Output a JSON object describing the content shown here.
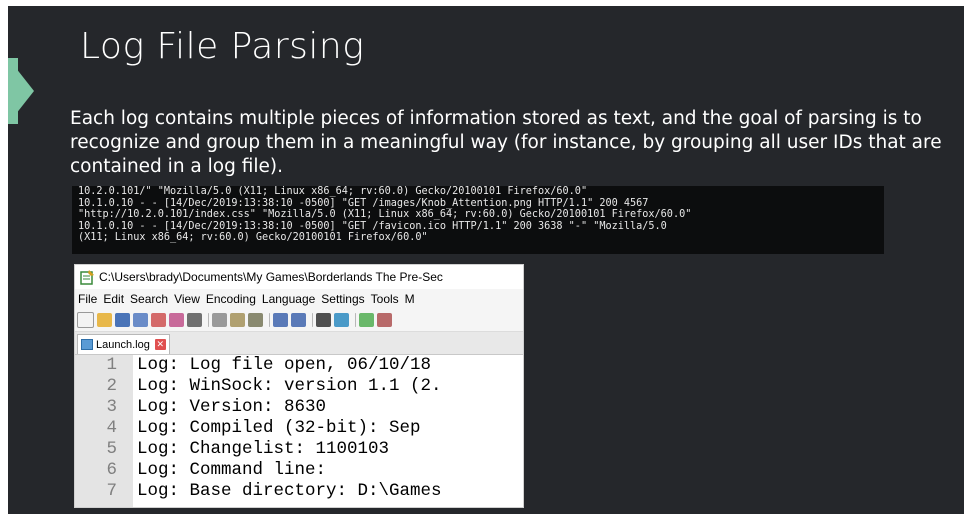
{
  "slide": {
    "title": "Log File Parsing",
    "body": "Each log contains multiple pieces of information stored as text, and the goal of parsing is to recognize and group them in a meaningful way (for instance, by grouping all user IDs that are contained in a log file).",
    "accent_color": "#7fc6a4",
    "background_color": "#25272b"
  },
  "terminal": {
    "lines": [
      "10.2.0.101/\" \"Mozilla/5.0 (X11; Linux x86_64; rv:60.0) Gecko/20100101 Firefox/60.0\"",
      "10.1.0.10 - - [14/Dec/2019:13:38:10 -0500] \"GET /images/Knob_Attention.png HTTP/1.1\" 200 4567",
      "\"http://10.2.0.101/index.css\" \"Mozilla/5.0 (X11; Linux x86_64; rv:60.0) Gecko/20100101 Firefox/60.0\"",
      "10.1.0.10 - - [14/Dec/2019:13:38:10 -0500] \"GET /favicon.ico HTTP/1.1\" 200 3638 \"-\" \"Mozilla/5.0",
      "(X11; Linux x86_64; rv:60.0) Gecko/20100101 Firefox/60.0\""
    ]
  },
  "notepad": {
    "window_title": "C:\\Users\\brady\\Documents\\My Games\\Borderlands The Pre-Sec",
    "menu": [
      "File",
      "Edit",
      "Search",
      "View",
      "Encoding",
      "Language",
      "Settings",
      "Tools",
      "M"
    ],
    "tab_label": "Launch.log",
    "tab_close": "✕",
    "lines": [
      {
        "num": "1",
        "text": "Log: Log file open, 06/10/18"
      },
      {
        "num": "2",
        "text": "Log: WinSock: version 1.1 (2."
      },
      {
        "num": "3",
        "text": "Log: Version: 8630"
      },
      {
        "num": "4",
        "text": "Log: Compiled (32-bit): Sep"
      },
      {
        "num": "5",
        "text": "Log: Changelist: 1100103"
      },
      {
        "num": "6",
        "text": "Log: Command line:"
      },
      {
        "num": "7",
        "text": "Log: Base directory: D:\\Games"
      }
    ]
  }
}
